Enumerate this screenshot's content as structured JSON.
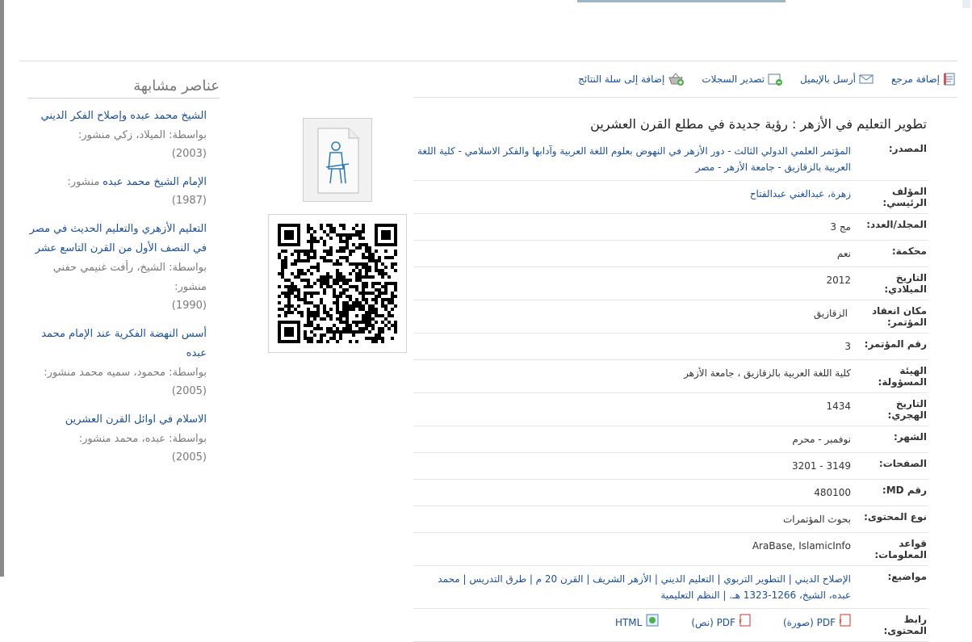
{
  "toolbar": {
    "add_reference": "إضافة مرجع",
    "send_email": "أرسل بالإيميل",
    "export_records": "تصدير السجلات",
    "add_to_basket": "إضافة إلى سلة النتائج"
  },
  "record": {
    "title": "تطوير التعليم في الأزهر : رؤية جديدة في مطلع القرن العشرين",
    "fields": {
      "source_label": "المصدر:",
      "source_value": "المؤتمر العلمي الدولي الثالث - دور الأزهر في النهوض بعلوم اللغة العربية وآدابها والفكر الاسلامي - كلية اللغة العربية بالزقازيق - جامعة الأزهر - مصر",
      "author_label": "المؤلف الرئيسي:",
      "author_value": "زهرة، عبدالغني عبدالفتاح",
      "volume_label": "المجلد/العدد:",
      "volume_value": "مج 3",
      "refereed_label": "محكمة:",
      "refereed_value": "نعم",
      "greg_date_label": "التاريخ الميلادي:",
      "greg_date_value": "2012",
      "conf_place_label": "مكان انعقاد المؤتمر:",
      "conf_place_value": "الزقازيق",
      "conf_num_label": "رقم المؤتمر:",
      "conf_num_value": "3",
      "body_label": "الهيئة المسؤولة:",
      "body_value": "كلية اللغة العربية بالزقازيق ، جامعة الأزهر",
      "hijri_label": "التاريخ الهجري:",
      "hijri_value": "1434",
      "month_label": "الشهر:",
      "month_value": "نوفمبر - محرم",
      "pages_label": "الصفحات:",
      "pages_value": "3149 - 3201",
      "md_label": "رقم MD:",
      "md_value": "480100",
      "content_type_label": "نوع المحتوى:",
      "content_type_value": "بحوث المؤتمرات",
      "databases_label": "قواعد المعلومات:",
      "databases_value": "AraBase, IslamicInfo",
      "subjects_label": "مواضيع:",
      "subjects_value": "الإصلاح الديني | التطوير التربوي | التعليم الديني | الأزهر الشريف | القرن 20 م | طرق التدريس | محمد عبده، الشيخ، 1266-1323 هـ. | النظم التعليمية",
      "content_link_label": "رابط المحتوى:",
      "pdf_image": "PDF (صورة)",
      "pdf_text": "PDF (نص)",
      "html": "HTML"
    }
  },
  "similar": {
    "heading": "عناصر مشابهة",
    "items": [
      {
        "title": "الشيخ محمد عبده وإصلاح الفكر الديني",
        "meta": "بواسطة: الميلاد، زكي منشور:",
        "year": "(2003)"
      },
      {
        "title": "الإمام الشيخ محمد عبده",
        "meta": "منشور:",
        "year": "(1987)"
      },
      {
        "title": "التعليم الأزهري والتعليم الحديث في مصر في النصف الأول من القرن التاسع عشر",
        "meta": "بواسطة: الشيخ، رأفت غنيمي حفني منشور:",
        "year": "(1990)"
      },
      {
        "title": "أسس النهضة الفكرية عند الإمام محمد عبده",
        "meta": "بواسطة: محمود، سميه محمد منشور:",
        "year": "(2005)"
      },
      {
        "title": "الاسلام في اوائل القرن العشرين",
        "meta": "بواسطة: عبده، محمد منشور:",
        "year": "(2005)"
      }
    ]
  },
  "colors": {
    "link": "#1a4fa0",
    "muted": "#7a7a7a",
    "border": "#e6e6e6"
  },
  "icons": [
    "reference-icon",
    "email-icon",
    "export-icon",
    "basket-icon",
    "pdf-icon",
    "html-icon",
    "document-thumbnail-icon",
    "qr-code-icon"
  ]
}
